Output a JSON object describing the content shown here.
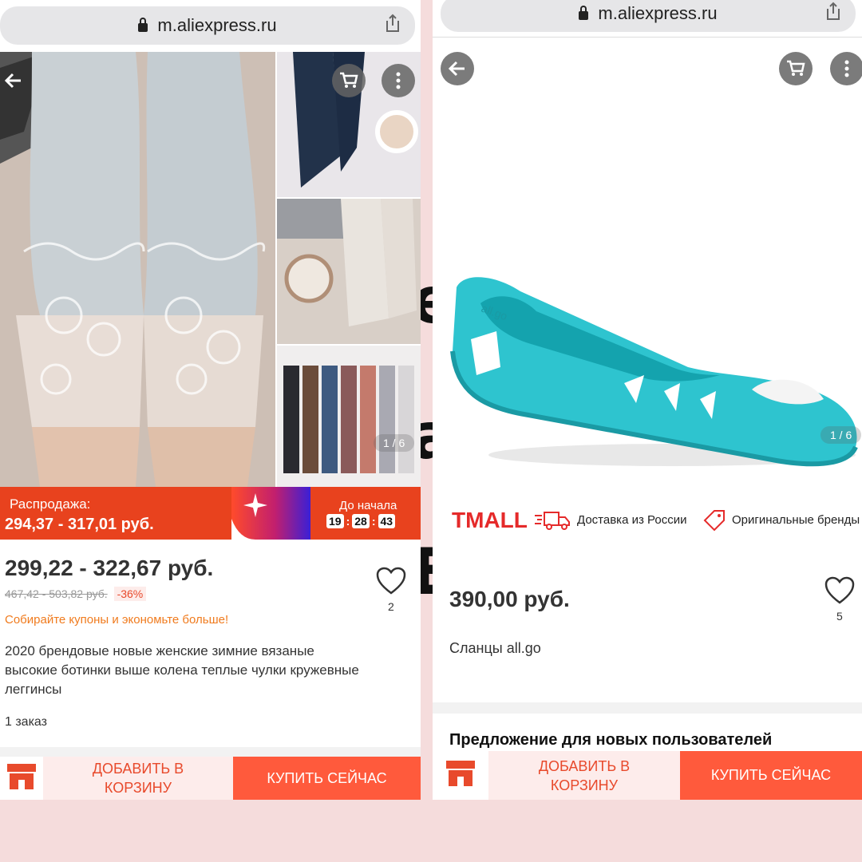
{
  "background_text": [
    "е",
    "а",
    "Е"
  ],
  "left_screen": {
    "url": "m.aliexpress.ru",
    "pager": "1 / 6",
    "sale": {
      "label": "Распродажа:",
      "range": "294,37 - 317,01 руб.",
      "countdown_label": "До начала",
      "timer": [
        "19",
        "28",
        "43"
      ]
    },
    "price": "299,22 - 322,67 руб.",
    "old_price": "467,42 - 503,82 руб.",
    "discount": "-36%",
    "coupon_text": "Собирайте купоны и экономьте больше!",
    "wishlist_count": "2",
    "title_lines": [
      "2020 брендовые новые женские зимние вязаные",
      "высокие ботинки выше колена теплые чулки кружевные",
      "леггинсы"
    ],
    "orders": "1 заказ",
    "add_to_cart_lines": [
      "ДОБАВИТЬ В",
      "КОРЗИНУ"
    ],
    "buy_now": "КУПИТЬ СЕЙЧАС"
  },
  "right_screen": {
    "url": "m.aliexpress.ru",
    "pager": "1 / 6",
    "tmall_logo": "TMALL",
    "badge_delivery": "Доставка из России",
    "badge_brands": "Оригинальные бренды",
    "price": "390,00 руб.",
    "wishlist_count": "5",
    "product_name": "Сланцы all.go",
    "shoe_brand": "all.go",
    "new_user_heading": "Предложение для новых пользователей",
    "add_to_cart_lines": [
      "ДОБАВИТЬ В",
      "КОРЗИНУ"
    ],
    "buy_now": "КУПИТЬ СЕЙЧАС"
  },
  "colors": {
    "accent": "#e8421e",
    "buy_button": "#ff5a3c",
    "add_to_cart_bg": "#fdeceb",
    "tmall_red": "#e52a2a",
    "shoe_teal": "#2ec4cf",
    "page_bg": "#f5dcdc"
  },
  "icons": [
    "lock-icon",
    "share-icon",
    "back-arrow-icon",
    "cart-icon",
    "more-icon",
    "heart-icon",
    "store-icon",
    "delivery-truck-icon",
    "brand-tag-icon"
  ]
}
